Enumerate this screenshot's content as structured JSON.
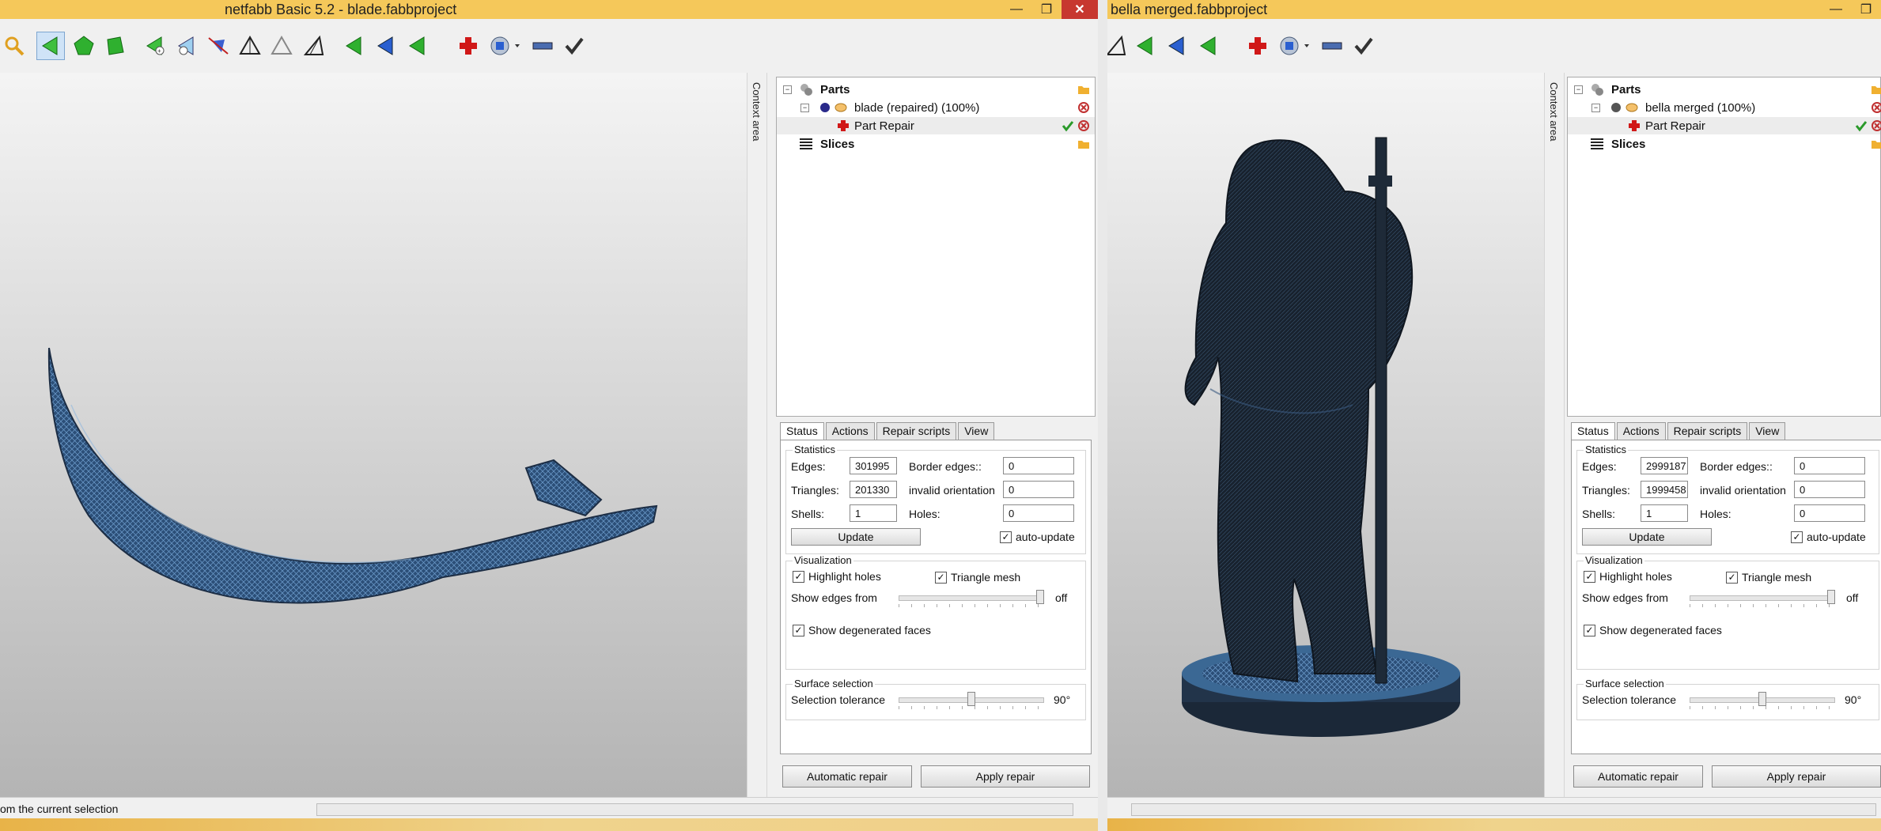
{
  "colors": {
    "titlebar": "#f5c85a",
    "close": "#c7372f",
    "mesh": "#3f6c99",
    "mesh_dark": "#1c2633"
  },
  "left": {
    "title": "netfabb Basic 5.2 - blade.fabbproject",
    "buttons": {
      "minimize": "—",
      "maximize": "❐",
      "close": "✕"
    },
    "context_area": "Context area",
    "tree": {
      "parts": "Parts",
      "part": "blade (repaired) (100%)",
      "repair": "Part Repair",
      "slices": "Slices"
    },
    "tabs": [
      "Status",
      "Actions",
      "Repair scripts",
      "View"
    ],
    "statistics": {
      "title": "Statistics",
      "edges_label": "Edges:",
      "edges": "301995",
      "triangles_label": "Triangles:",
      "triangles": "201330",
      "shells_label": "Shells:",
      "shells": "1",
      "border_label": "Border edges::",
      "border": "0",
      "invalid_label": "invalid orientation",
      "invalid": "0",
      "holes_label": "Holes:",
      "holes": "0",
      "update": "Update",
      "auto_update": "auto-update"
    },
    "visualization": {
      "title": "Visualization",
      "highlight": "Highlight holes",
      "triangle_mesh": "Triangle mesh",
      "show_edges": "Show edges from",
      "off": "off",
      "degenerated": "Show degenerated faces"
    },
    "surface": {
      "title": "Surface selection",
      "tolerance": "Selection tolerance",
      "value": "90°"
    },
    "automatic_repair": "Automatic repair",
    "apply_repair": "Apply repair",
    "status": "om the current selection"
  },
  "right": {
    "title": "bella merged.fabbproject",
    "buttons": {
      "minimize": "—",
      "maximize": "❐"
    },
    "context_area": "Context area",
    "tree": {
      "parts": "Parts",
      "part": "bella merged (100%)",
      "repair": "Part Repair",
      "slices": "Slices"
    },
    "tabs": [
      "Status",
      "Actions",
      "Repair scripts",
      "View"
    ],
    "statistics": {
      "title": "Statistics",
      "edges_label": "Edges:",
      "edges": "2999187",
      "triangles_label": "Triangles:",
      "triangles": "1999458",
      "shells_label": "Shells:",
      "shells": "1",
      "border_label": "Border edges::",
      "border": "0",
      "invalid_label": "invalid orientation",
      "invalid": "0",
      "holes_label": "Holes:",
      "holes": "0",
      "update": "Update",
      "auto_update": "auto-update"
    },
    "visualization": {
      "title": "Visualization",
      "highlight": "Highlight holes",
      "triangle_mesh": "Triangle mesh",
      "show_edges": "Show edges from",
      "off": "off",
      "degenerated": "Show degenerated faces"
    },
    "surface": {
      "title": "Surface selection",
      "tolerance": "Selection tolerance",
      "value": "90°"
    },
    "automatic_repair": "Automatic repair",
    "apply_repair": "Apply repair"
  }
}
